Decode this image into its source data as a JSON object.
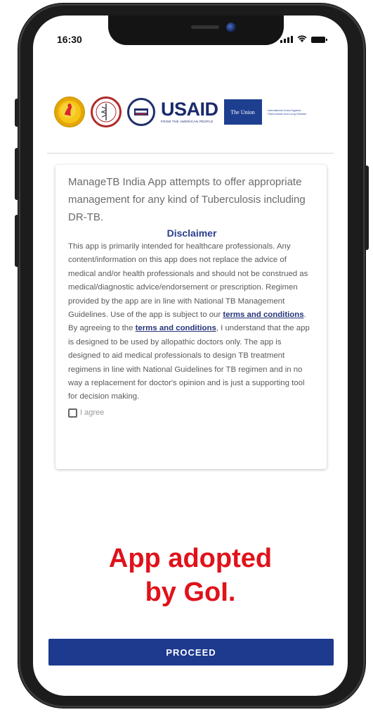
{
  "status_bar": {
    "time": "16:30"
  },
  "logos": {
    "usaid": "USAID",
    "usaid_sub": "FROM THE AMERICAN PEOPLE",
    "union": "The Union",
    "union_sub": "International Union Against Tuberculosis and Lung Disease"
  },
  "card": {
    "intro": "ManageTB India App attempts to offer appropriate management for any kind of Tuberculosis including DR-TB.",
    "disclaimer_title": "Disclaimer",
    "body_part1": "This app is primarily intended for healthcare professionals. Any content/information on this app does not replace the advice of medical and/or health professionals and should not be construed as medical/diagnostic advice/endorsement or prescription. Regimen provided by the app are in line with National TB Management Guidelines. Use of the app is subject to our ",
    "link1": "terms and conditions",
    "body_part2": ". By agreeing to the ",
    "link2": "terms and conditions",
    "body_part3": ", I understand that the app is designed to be used by allopathic doctors only. The app is designed to aid medical professionals to design TB treatment regimens in line with National Guidelines for TB regimen and in no way a replacement for doctor's opinion and is just a supporting tool for decision making.",
    "agree_label": "I agree"
  },
  "annotation": {
    "line1": "App adopted",
    "line2": "by GoI."
  },
  "proceed_label": "PROCEED",
  "colors": {
    "accent": "#1d3a8f",
    "annotation_red": "#e0121a"
  }
}
